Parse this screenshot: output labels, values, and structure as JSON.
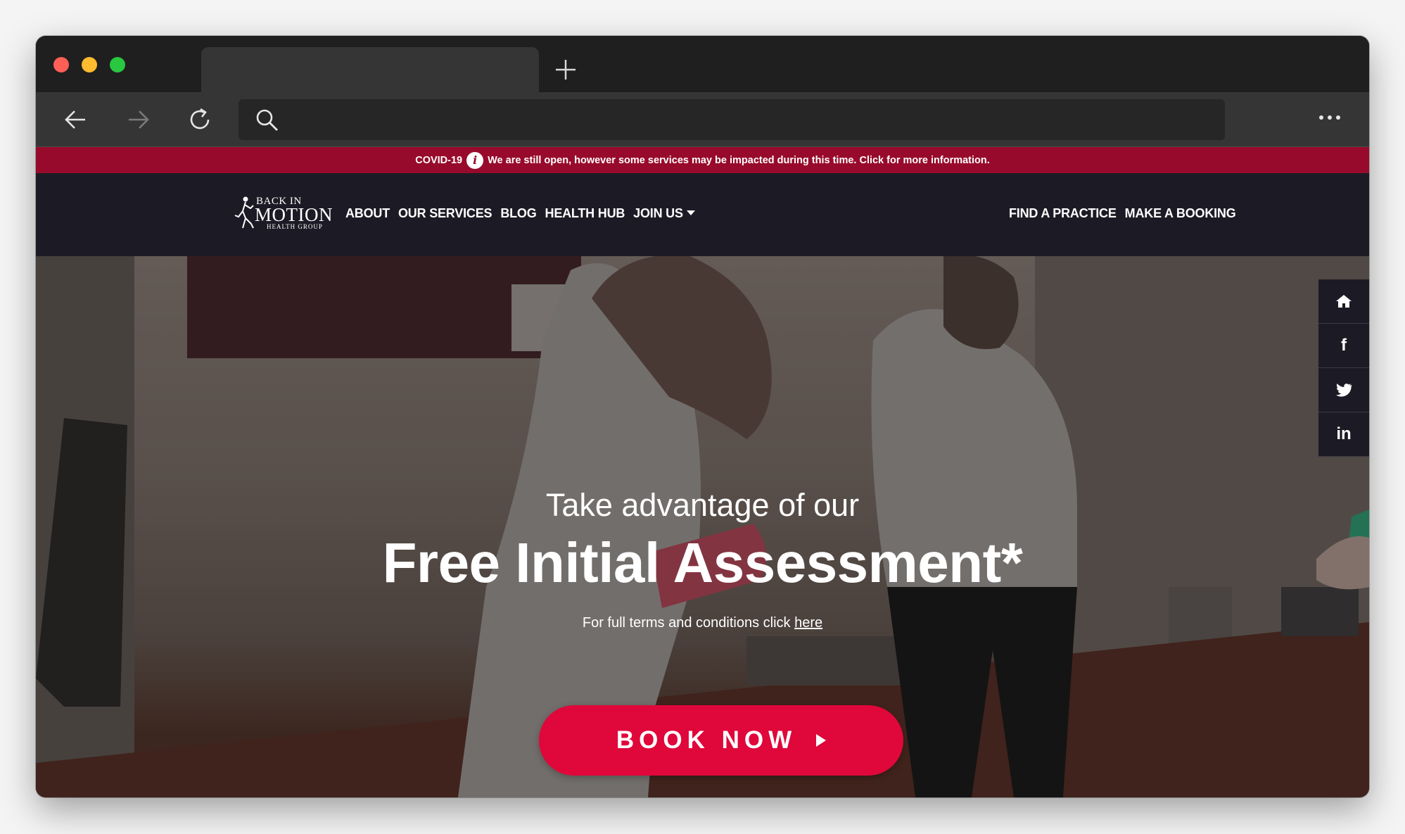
{
  "browser": {
    "tab_title": "",
    "address": "",
    "colors": {
      "close": "#ff5f57",
      "minimize": "#febc2e",
      "zoom": "#28c840"
    }
  },
  "banner": {
    "lead": "COVID-19",
    "info_icon": "i",
    "message": "We are still open, however some services may be impacted during this time. Click for more information."
  },
  "logo": {
    "line1": "BACK IN",
    "line2": "MOTION",
    "line3": "HEALTH GROUP"
  },
  "nav": {
    "items": [
      "ABOUT",
      "OUR SERVICES",
      "BLOG",
      "HEALTH HUB",
      "JOIN US"
    ],
    "right": [
      "FIND A PRACTICE",
      "MAKE A BOOKING"
    ]
  },
  "social": {
    "icons": [
      "home-icon",
      "facebook-icon",
      "twitter-icon",
      "linkedin-icon"
    ],
    "glyphs": [
      "",
      "f",
      "",
      "in"
    ]
  },
  "hero": {
    "subtitle": "Take advantage of our",
    "title": "Free Initial Assessment*",
    "terms": "For full terms and conditions click",
    "terms_link": "here",
    "cta": "BOOK NOW"
  },
  "colors": {
    "banner": "#980a2b",
    "navbar": "#1c1b25",
    "cta": "#e0073a"
  }
}
